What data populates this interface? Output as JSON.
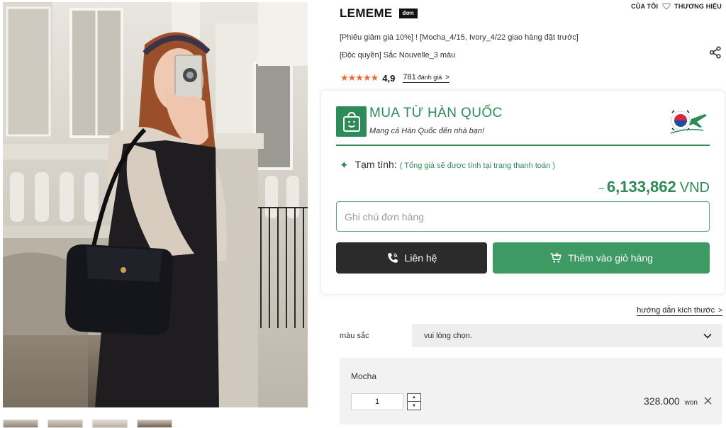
{
  "header": {
    "brand": "LEMEME",
    "brand_badge": "đơn",
    "my_link": "CỦA TÔI",
    "brand_link": "THƯƠNG HIỆU"
  },
  "product": {
    "promo_line_1": "[Phiếu giảm giá 10%] ! [Mocha_4/15, Ivory_4/22 giao hàng đặt trước]",
    "promo_line_2": "[Độc quyền] Sắc Nouvelle_3 màu",
    "rating_stars": "★★★★★",
    "rating_value": "4,9",
    "review_count": "781",
    "review_label": "đánh giá",
    "review_chevron": ">"
  },
  "purchase": {
    "title": "MUA TỪ HÀN QUỐC",
    "subtitle": "Mang cả Hàn Quốc đến nhà bạn!",
    "estimate_label": "Tạm tính:",
    "estimate_note": "( Tổng giá sẽ được tính tại trang thanh toán )",
    "price_prefix": "~",
    "price_amount": "6,133,862",
    "price_currency": "VND",
    "note_placeholder": "Ghi chú đơn hàng",
    "contact_label": "Liên hệ",
    "cart_label": "Thêm vào giỏ hàng"
  },
  "options": {
    "size_guide": "hướng dẫn kích thước",
    "size_guide_chevron": ">",
    "color_label": "màu sắc",
    "color_select_value": "vui lòng chọn.",
    "selected": {
      "name": "Mocha",
      "quantity": "1",
      "price": "328.000",
      "unit": "won"
    }
  },
  "colors": {
    "accent_green": "#2e8b57",
    "button_green": "#3e9a63",
    "dark": "#2b2b2b",
    "star_orange": "#ec6a2c"
  },
  "icons": {
    "heart": "heart-icon",
    "share": "share-icon",
    "bag": "shopping-bag-icon",
    "flag_plane": "korea-flag-plane-icon",
    "sparkle": "sparkle-icon",
    "phone": "phone-icon",
    "cart": "cart-icon",
    "dropdown": "chevron-down-icon",
    "close": "close-icon"
  }
}
